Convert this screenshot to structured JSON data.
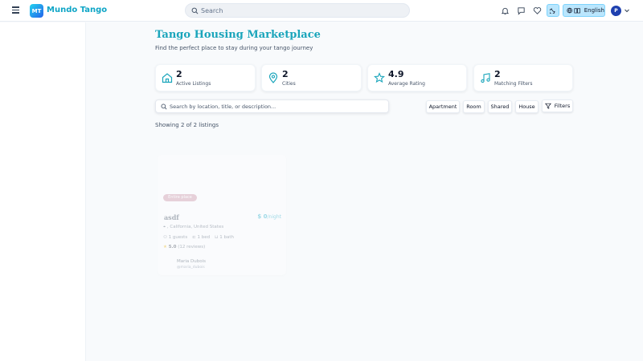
{
  "app": {
    "logo_initials": "MT",
    "name": "Mundo Tango"
  },
  "topbar": {
    "search_placeholder": "Search",
    "language_label": "English",
    "avatar_initial": "P",
    "icons": [
      "menu-icon",
      "search-icon",
      "bell-icon",
      "message-icon",
      "heart-icon",
      "moon-icon",
      "globe-icon",
      "book-icon",
      "chevron-down-icon"
    ]
  },
  "page": {
    "title": "Tango Housing Marketplace",
    "subtitle": "Find the perfect place to stay during your tango journey"
  },
  "stats": [
    {
      "value": "2",
      "label": "Active Listings",
      "icon": "home-icon"
    },
    {
      "value": "2",
      "label": "Cities",
      "icon": "map-pin-icon"
    },
    {
      "value": "4.9",
      "label": "Average Rating",
      "icon": "star-icon"
    },
    {
      "value": "2",
      "label": "Matching Filters",
      "icon": "music-icon"
    }
  ],
  "search": {
    "placeholder": "Search by location, title, or description..."
  },
  "filters": {
    "chips": [
      "Apartment",
      "Room",
      "Shared",
      "House"
    ],
    "filters_label": "Filters"
  },
  "results": {
    "showing_text": "Showing 2 of 2 listings"
  },
  "listing": {
    "badge": "Entire place",
    "title": "asdf",
    "price_value": "$ 0",
    "price_unit": "/night",
    "location": ", California, United States",
    "guests": "1 guests",
    "beds": "1 bed",
    "baths": "1 bath",
    "rating": "5.0",
    "reviews": "(12 reviews)",
    "host_name": "Maria Dubois",
    "host_handle": "@maria_dubois"
  },
  "colors": {
    "accent": "#1aa5bb",
    "brand_gradient_start": "#22d3ee",
    "brand_gradient_end": "#2563eb",
    "toggle_bg": "#bae6fd"
  }
}
